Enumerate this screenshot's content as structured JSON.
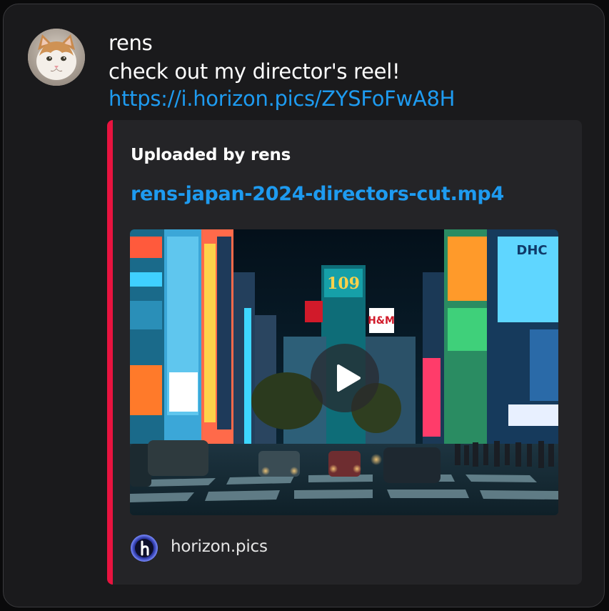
{
  "message": {
    "username": "rens",
    "text": "check out my director's reel!",
    "link": "https://i.horizon.pics/ZYSFoFwA8H",
    "avatar_icon": "cat-avatar"
  },
  "embed": {
    "accent_color": "#e8133f",
    "author": "Uploaded by rens",
    "title": "rens-japan-2024-directors-cut.mp4",
    "video_thumbnail": "shibuya-night-street-scene",
    "play_icon": "play-icon",
    "footer": {
      "site_name": "horizon.pics",
      "icon": "horizon-logo-icon"
    }
  },
  "colors": {
    "background": "#1a1a1c",
    "embed_background": "#242427",
    "link": "#1e9bf0",
    "text": "#ffffff"
  }
}
